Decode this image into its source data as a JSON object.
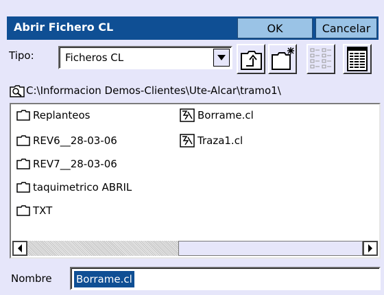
{
  "dialog": {
    "title": "Abrir Fichero CL",
    "ok_label": "OK",
    "cancel_label": "Cancelar"
  },
  "filter": {
    "label": "Tipo:",
    "value": "Ficheros CL"
  },
  "toolbar": {
    "icons": [
      "folder-up-icon",
      "new-folder-icon",
      "list-view-icon",
      "details-view-icon"
    ]
  },
  "path": {
    "text": "C:\\Informacion Demos-Clientes\\Ute-Alcar\\tramo1\\"
  },
  "files": {
    "folders": [
      "Replanteos",
      "REV6__28-03-06",
      "REV7__28-03-06",
      "taquimetrico ABRIL",
      "TXT"
    ],
    "files": [
      "Borrame.cl",
      "Traza1.cl"
    ]
  },
  "scrollbar": {
    "position_fraction": 0.0,
    "visible_fraction": 0.55
  },
  "name": {
    "label": "Nombre",
    "value": "Borrame.cl"
  },
  "colors": {
    "title_bar": "#0f4f94",
    "button": "#9ac3e6",
    "background": "#e6e6fa",
    "selection": "#0f4f94"
  }
}
